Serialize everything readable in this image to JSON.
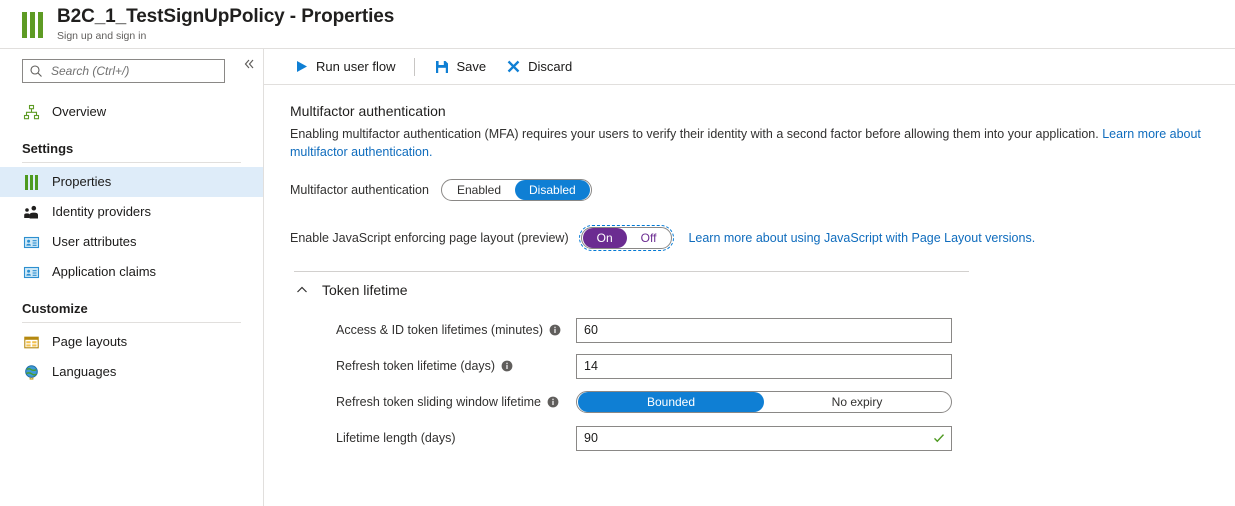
{
  "header": {
    "title": "B2C_1_TestSignUpPolicy - Properties",
    "subtitle": "Sign up and sign in",
    "icon": "policy-bars-icon"
  },
  "sidebar": {
    "collapse_icon": "chevron-double-left-icon",
    "search": {
      "placeholder": "Search (Ctrl+/)",
      "value": "",
      "icon": "search-icon"
    },
    "items": [
      {
        "label": "Overview",
        "icon": "overview-hierarchy-icon",
        "selected": false
      },
      {
        "label": "Properties",
        "icon": "properties-bars-icon",
        "selected": true
      },
      {
        "label": "Identity providers",
        "icon": "identity-providers-icon",
        "selected": false
      },
      {
        "label": "User attributes",
        "icon": "user-attributes-card-icon",
        "selected": false
      },
      {
        "label": "Application claims",
        "icon": "application-claims-card-icon",
        "selected": false
      },
      {
        "label": "Page layouts",
        "icon": "page-layouts-grid-icon",
        "selected": false
      },
      {
        "label": "Languages",
        "icon": "languages-globe-icon",
        "selected": false
      }
    ],
    "groups": {
      "settings": "Settings",
      "customize": "Customize"
    }
  },
  "toolbar": {
    "run_label": "Run user flow",
    "run_icon": "play-icon",
    "save_label": "Save",
    "save_icon": "save-floppy-icon",
    "discard_label": "Discard",
    "discard_icon": "close-x-icon"
  },
  "main": {
    "mfa": {
      "title": "Multifactor authentication",
      "description_part1": "Enabling multifactor authentication (MFA) requires your users to verify their identity with a second factor before allowing them into your application. ",
      "description_link": "Learn more about multifactor authentication.",
      "field_label": "Multifactor authentication",
      "options": [
        "Enabled",
        "Disabled"
      ],
      "selected": "Disabled"
    },
    "javascript": {
      "field_label": "Enable JavaScript enforcing page layout (preview)",
      "options": [
        "On",
        "Off"
      ],
      "selected": "On",
      "link": "Learn more about using JavaScript with Page Layout versions."
    },
    "token_lifetime": {
      "title": "Token lifetime",
      "expanded": true,
      "chevron_icon": "chevron-up-icon",
      "fields": [
        {
          "label": "Access & ID token lifetimes (minutes)",
          "has_info": true,
          "type": "text",
          "value": "60",
          "valid": false
        },
        {
          "label": "Refresh token lifetime (days)",
          "has_info": true,
          "type": "text",
          "value": "14",
          "valid": false
        },
        {
          "label": "Refresh token sliding window lifetime",
          "has_info": true,
          "type": "choice",
          "options": [
            "Bounded",
            "No expiry"
          ],
          "selected": "Bounded"
        },
        {
          "label": "Lifetime length (days)",
          "has_info": false,
          "type": "text",
          "value": "90",
          "valid": true
        }
      ]
    }
  },
  "colors": {
    "accent_blue": "#0f7fd4",
    "accent_purple": "#6B2C91",
    "link_blue": "#0f6cbd",
    "brand_green": "#5E9B24",
    "selected_nav_bg": "#deecf9",
    "valid_green": "#4F9A22"
  }
}
